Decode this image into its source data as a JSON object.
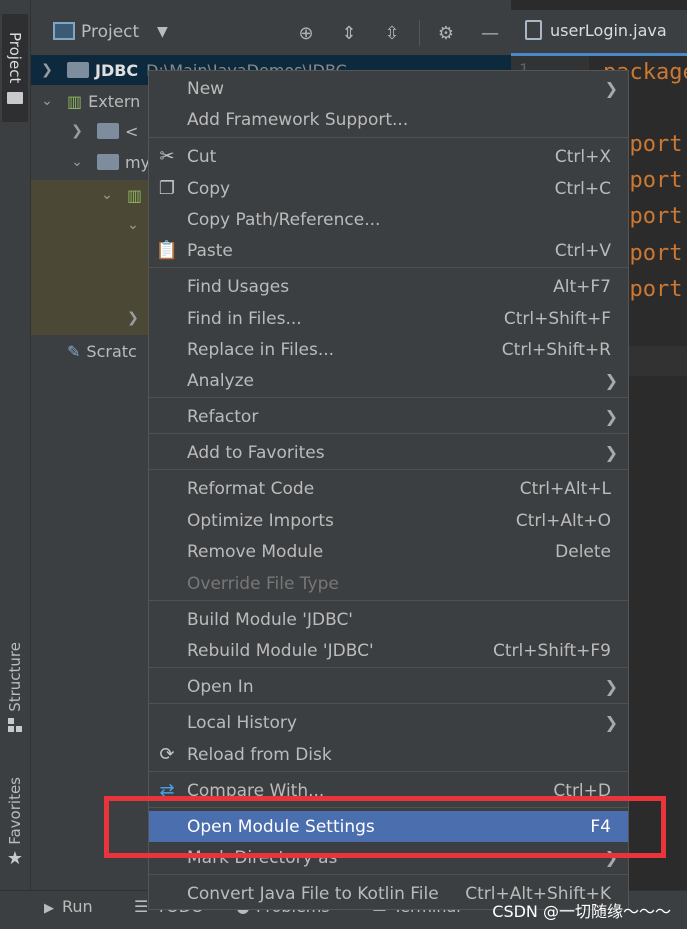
{
  "sidebar": {
    "project_tab": "Project",
    "structure_tab": "Structure",
    "favorites_tab": "Favorites"
  },
  "project_panel": {
    "title": "Project",
    "tree": {
      "root_name": "JDBC",
      "root_path": "D:\\Main\\JavaDemos\\JDBC",
      "external": "Extern",
      "child1": "<",
      "child2": "my",
      "scratches": "Scratc"
    }
  },
  "editor": {
    "tab_label": "userLogin.java",
    "line_number": "1",
    "lines": [
      "package",
      "import",
      "import",
      "import",
      "import",
      "import"
    ]
  },
  "bottom_bar": {
    "run": "Run",
    "todo": "TODO",
    "problems": "Problems",
    "terminal": "Terminal",
    "watermark": "CSDN @一切随缘～～～"
  },
  "context_menu": {
    "items": [
      {
        "label": "New",
        "shortcut": "",
        "submenu": true
      },
      {
        "label": "Add Framework Support...",
        "shortcut": "",
        "submenu": false
      },
      {
        "label": "Cut",
        "shortcut": "Ctrl+X",
        "icon": "cut-icon"
      },
      {
        "label": "Copy",
        "shortcut": "Ctrl+C",
        "icon": "copy-icon"
      },
      {
        "label": "Copy Path/Reference...",
        "shortcut": ""
      },
      {
        "label": "Paste",
        "shortcut": "Ctrl+V",
        "icon": "paste-icon"
      },
      {
        "label": "Find Usages",
        "shortcut": "Alt+F7"
      },
      {
        "label": "Find in Files...",
        "shortcut": "Ctrl+Shift+F"
      },
      {
        "label": "Replace in Files...",
        "shortcut": "Ctrl+Shift+R"
      },
      {
        "label": "Analyze",
        "shortcut": "",
        "submenu": true
      },
      {
        "label": "Refactor",
        "shortcut": "",
        "submenu": true
      },
      {
        "label": "Add to Favorites",
        "shortcut": "",
        "submenu": true
      },
      {
        "label": "Reformat Code",
        "shortcut": "Ctrl+Alt+L"
      },
      {
        "label": "Optimize Imports",
        "shortcut": "Ctrl+Alt+O"
      },
      {
        "label": "Remove Module",
        "shortcut": "Delete"
      },
      {
        "label": "Override File Type",
        "shortcut": "",
        "disabled": true
      },
      {
        "label": "Build Module 'JDBC'",
        "shortcut": ""
      },
      {
        "label": "Rebuild Module 'JDBC'",
        "shortcut": "Ctrl+Shift+F9"
      },
      {
        "label": "Open In",
        "shortcut": "",
        "submenu": true
      },
      {
        "label": "Local History",
        "shortcut": "",
        "submenu": true
      },
      {
        "label": "Reload from Disk",
        "shortcut": "",
        "icon": "reload-icon"
      },
      {
        "label": "Compare With...",
        "shortcut": "Ctrl+D",
        "icon": "compare-icon"
      },
      {
        "label": "Open Module Settings",
        "shortcut": "F4",
        "active": true
      },
      {
        "label": "Mark Directory as",
        "shortcut": "",
        "submenu": true
      },
      {
        "label": "Convert Java File to Kotlin File",
        "shortcut": "Ctrl+Alt+Shift+K"
      }
    ]
  },
  "colors": {
    "highlight": "#4b6eaf",
    "annotation_box": "#e8343a",
    "menu_bg": "#3c3f41",
    "editor_bg": "#2b2b2b"
  }
}
